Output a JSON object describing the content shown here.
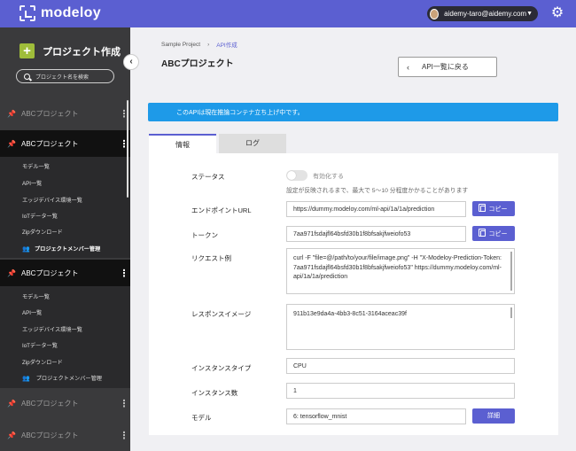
{
  "app": {
    "name": "modeloy"
  },
  "header": {
    "user_email": "aidemy-taro@aidemy.com"
  },
  "sidebar": {
    "create_label": "プロジェクト作成",
    "search_placeholder": "プロジェクト名を検索",
    "projects": [
      {
        "name": "ABCプロジェクト",
        "active": false
      },
      {
        "name": "ABCプロジェクト",
        "active": true
      },
      {
        "name": "ABCプロジェクト",
        "active": true
      },
      {
        "name": "ABCプロジェクト",
        "active": false
      },
      {
        "name": "ABCプロジェクト",
        "active": false
      }
    ],
    "sub_items_a": [
      "モデル一覧",
      "API一覧",
      "エッジデバイス環境一覧",
      "IoTデーター覧",
      "Zipダウンロード",
      "プロジェクトメンバー管理"
    ],
    "sub_items_b": [
      "モデル一覧",
      "API一覧",
      "エッジデバイス環境一覧",
      "IoTデーター覧",
      "Zipダウンロード",
      "プロジェクトメンバー管理"
    ]
  },
  "breadcrumb": {
    "project": "Sample Project",
    "current": "API作成"
  },
  "page": {
    "title": "ABCプロジェクト",
    "back_label": "API一覧に戻る"
  },
  "banner": {
    "text": "このAPIは現在推論コンテナ立ち上げ中です。"
  },
  "tabs": {
    "info": "情報",
    "log": "ログ"
  },
  "info": {
    "status_label": "ステータス",
    "status_toggle_label": "有効化する",
    "status_note": "設定が反映されるまで、最大で 5〜10 分程度かかることがあります",
    "endpoint_label": "エンドポイントURL",
    "endpoint_value": "https://dummy.modeloy.com/ml-api/1a/1a/prediction",
    "token_label": "トークン",
    "token_value": "7aa971fsdajfl64bsfd30b1f8bfsakjfweiofo53",
    "copy_label": "コピー",
    "request_label": "リクエスト例",
    "request_value": "curl -F \"file=@/path/to/your/file/image.png\" -H \"X-Modeloy-Prediction-Token: 7aa971fsdajfl64bsfd30b1f8bfsakjfweiofo53\" https://dummy.modeloy.com/ml-api/1a/1a/prediction",
    "response_label": "レスポンスイメージ",
    "response_value": "911b13e9da4a-4bb3-8c51-3164aceac39f",
    "instance_type_label": "インスタンスタイプ",
    "instance_type_value": "CPU",
    "instance_count_label": "インスタンス数",
    "instance_count_value": "1",
    "model_label": "モデル",
    "model_value": "6: tensorflow_mnist",
    "detail_label": "詳細"
  },
  "colors": {
    "accent": "#5b5fd1",
    "banner": "#1e9ae8",
    "plus": "#9fbd3a",
    "pin_active": "#e7c43a"
  }
}
